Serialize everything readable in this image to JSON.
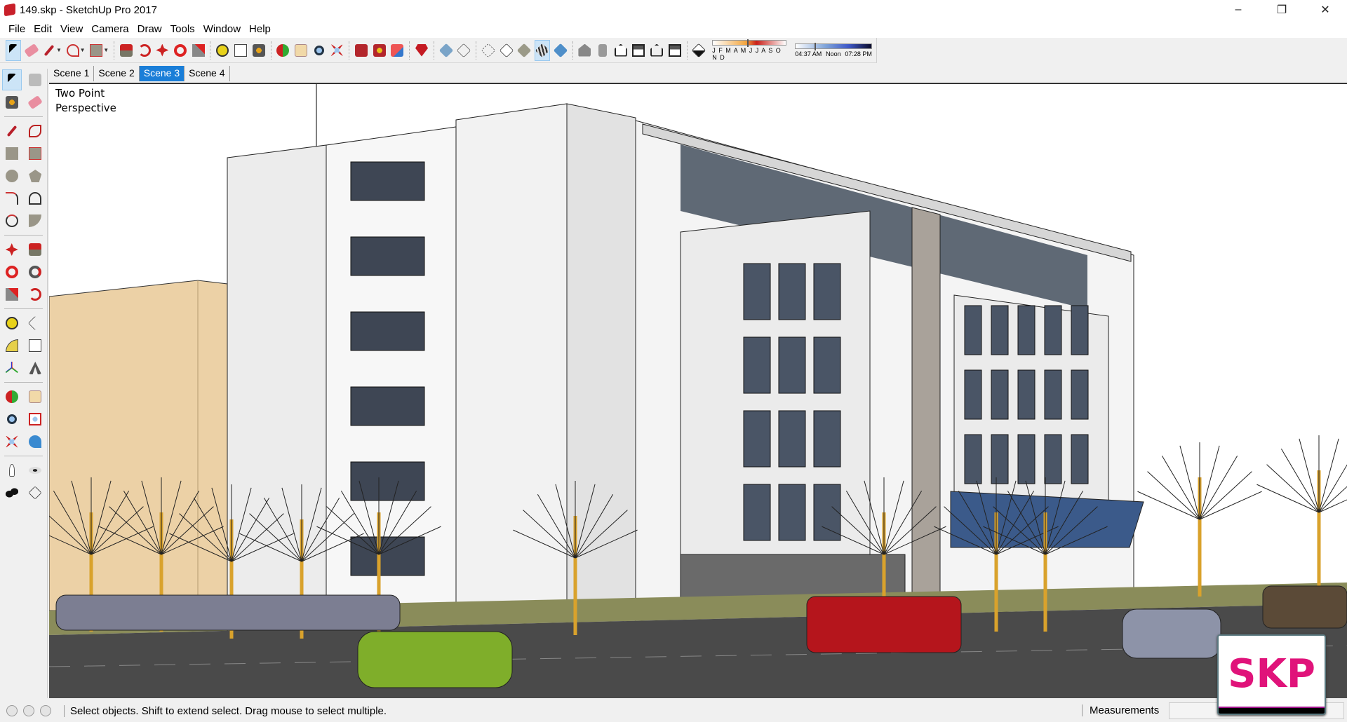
{
  "window": {
    "title": "149.skp - SketchUp Pro 2017",
    "minimize": "–",
    "restore": "❐",
    "close": "✕"
  },
  "menu": [
    "File",
    "Edit",
    "View",
    "Camera",
    "Draw",
    "Tools",
    "Window",
    "Help"
  ],
  "scenes": [
    {
      "label": "Scene 1"
    },
    {
      "label": "Scene 2"
    },
    {
      "label": "Scene 3",
      "active": true
    },
    {
      "label": "Scene 4"
    }
  ],
  "shadows": {
    "months": "J F M A M J J A S O N D",
    "time_start": "04:37 AM",
    "time_mid": "Noon",
    "time_end": "07:28 PM",
    "month_value": 0.47,
    "time_value": 0.25
  },
  "viewport": {
    "camera_label_1": "Two Point",
    "camera_label_2": "Perspective"
  },
  "status": {
    "text": "Select objects. Shift to extend select. Drag mouse to select multiple.",
    "measurements_label": "Measurements",
    "measurements_value": ""
  },
  "watermark": {
    "text": "SKP"
  },
  "colors": {
    "accent": "#1a7ed8",
    "watermark": "#e0137a"
  }
}
